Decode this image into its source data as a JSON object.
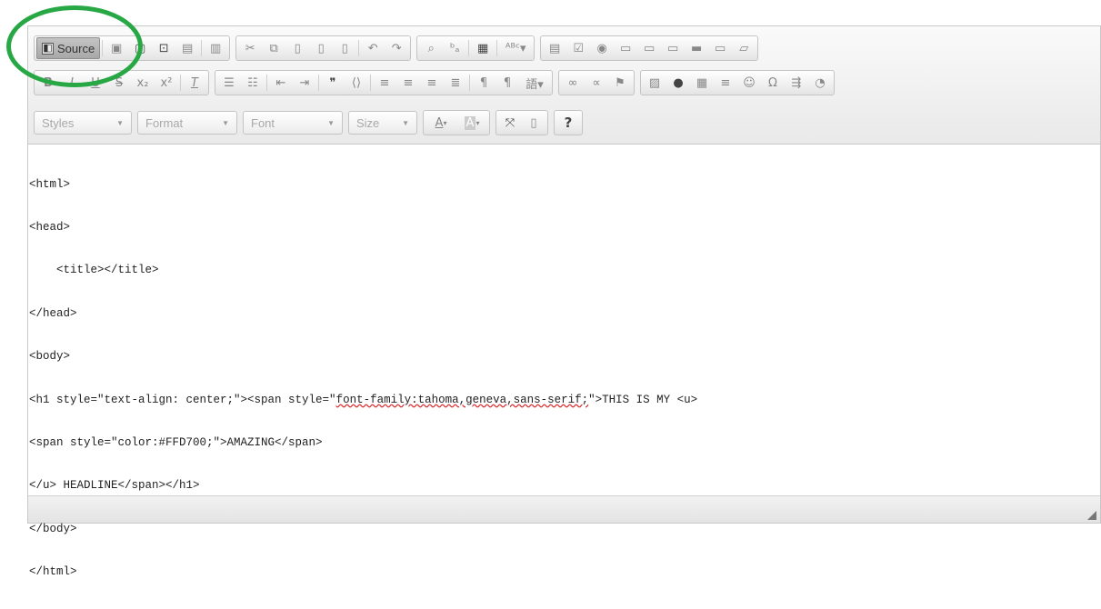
{
  "toolbar": {
    "source_label": "Source",
    "combos": [
      {
        "name": "styles",
        "label": "Styles"
      },
      {
        "name": "format",
        "label": "Format"
      },
      {
        "name": "font",
        "label": "Font"
      },
      {
        "name": "size",
        "label": "Size"
      }
    ],
    "help_label": "?",
    "text_color_label": "A",
    "bg_color_label": "A"
  },
  "source_code": {
    "lines": [
      "<html>",
      "<head>",
      "    <title></title>",
      "</head>",
      "<body>",
      "<h1 style=\"text-align: center;\"><span style=\"",
      "font-family:tahoma,geneva,sans-serif;",
      "\">THIS IS MY <u>",
      "<span style=\"color:#FFD700;\">AMAZING</span>",
      "</u> HEADLINE</span></h1>",
      "</body>",
      "</html>"
    ]
  },
  "colors": {
    "highlight": "#27a844",
    "spell_underline": "#d33"
  }
}
